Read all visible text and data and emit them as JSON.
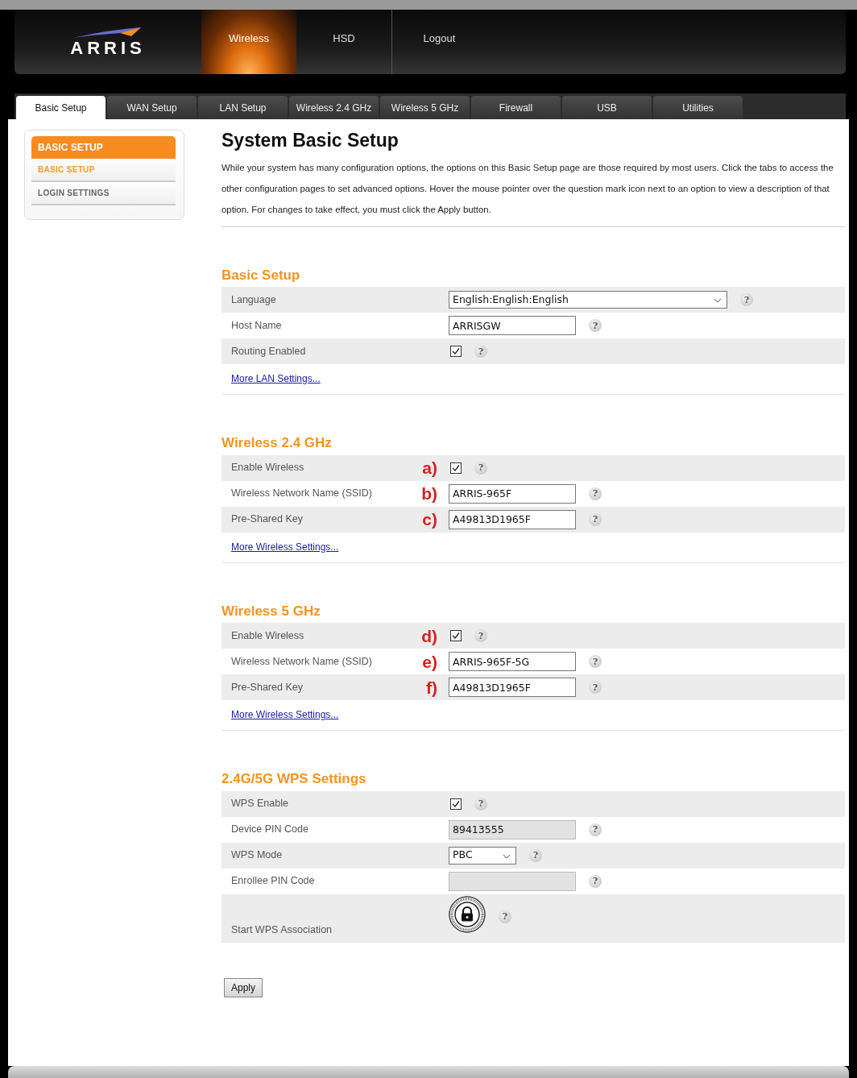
{
  "logo": "ARRIS",
  "top_nav": [
    {
      "label": "Wireless",
      "selected": true
    },
    {
      "label": "HSD",
      "selected": false
    },
    {
      "label": "Logout",
      "selected": false
    }
  ],
  "tabs": [
    {
      "label": "Basic Setup",
      "selected": true
    },
    {
      "label": "WAN Setup",
      "selected": false
    },
    {
      "label": "LAN Setup",
      "selected": false
    },
    {
      "label": "Wireless 2.4 GHz",
      "selected": false
    },
    {
      "label": "Wireless 5 GHz",
      "selected": false
    },
    {
      "label": "Firewall",
      "selected": false
    },
    {
      "label": "USB",
      "selected": false
    },
    {
      "label": "Utilities",
      "selected": false
    }
  ],
  "sidebar": {
    "title": "BASIC SETUP",
    "items": [
      {
        "label": "BASIC SETUP",
        "selected": true
      },
      {
        "label": "LOGIN SETTINGS",
        "selected": false
      }
    ]
  },
  "page": {
    "title": "System Basic Setup",
    "description": "While your system has many configuration options, the options on this Basic Setup page are those required by most users. Click the tabs to access the other configuration pages to set advanced options. Hover the mouse pointer over the question mark icon next to an option to view a description of that option. For changes to take effect, you must click the Apply button."
  },
  "sections": [
    {
      "title": "Basic Setup",
      "rows": [
        {
          "label": "Language",
          "kind": "select",
          "value": "English:English:English",
          "help": "?"
        },
        {
          "label": "Host Name",
          "kind": "text",
          "value": "ARRISGW",
          "disabled": false,
          "help": "?"
        },
        {
          "label": "Routing Enabled",
          "kind": "checkbox",
          "checked": true,
          "help": "?"
        }
      ],
      "link": "More LAN Settings..."
    },
    {
      "title": "Wireless 2.4 GHz",
      "rows": [
        {
          "label": "Enable Wireless",
          "marker": "a)",
          "kind": "checkbox",
          "checked": true,
          "help": "?"
        },
        {
          "label": "Wireless Network Name (SSID)",
          "marker": "b)",
          "kind": "text",
          "value": "ARRIS-965F",
          "disabled": false,
          "help": "?"
        },
        {
          "label": "Pre-Shared Key",
          "marker": "c)",
          "kind": "text",
          "value": "A49813D1965F",
          "disabled": false,
          "help": "?"
        }
      ],
      "link": "More Wireless Settings..."
    },
    {
      "title": "Wireless 5 GHz",
      "rows": [
        {
          "label": "Enable Wireless",
          "marker": "d)",
          "kind": "checkbox",
          "checked": true,
          "help": "?"
        },
        {
          "label": "Wireless Network Name (SSID)",
          "marker": "e)",
          "kind": "text",
          "value": "ARRIS-965F-5G",
          "disabled": false,
          "help": "?"
        },
        {
          "label": "Pre-Shared Key",
          "marker": "f)",
          "kind": "text",
          "value": "A49813D1965F",
          "disabled": false,
          "help": "?"
        }
      ],
      "link": "More Wireless Settings..."
    },
    {
      "title": "2.4G/5G WPS Settings",
      "rows": [
        {
          "label": "WPS Enable",
          "kind": "checkbox",
          "checked": true,
          "help": "?"
        },
        {
          "label": "Device PIN Code",
          "kind": "text",
          "value": "89413555",
          "disabled": true,
          "help": "?"
        },
        {
          "label": "WPS Mode",
          "kind": "select",
          "value": "PBC",
          "help": "?"
        },
        {
          "label": "Enrollee PIN Code",
          "kind": "text",
          "disabled": true,
          "help": "?"
        },
        {
          "label": "Start WPS Association",
          "kind": "wps",
          "help": "?"
        }
      ]
    }
  ],
  "apply": "Apply"
}
